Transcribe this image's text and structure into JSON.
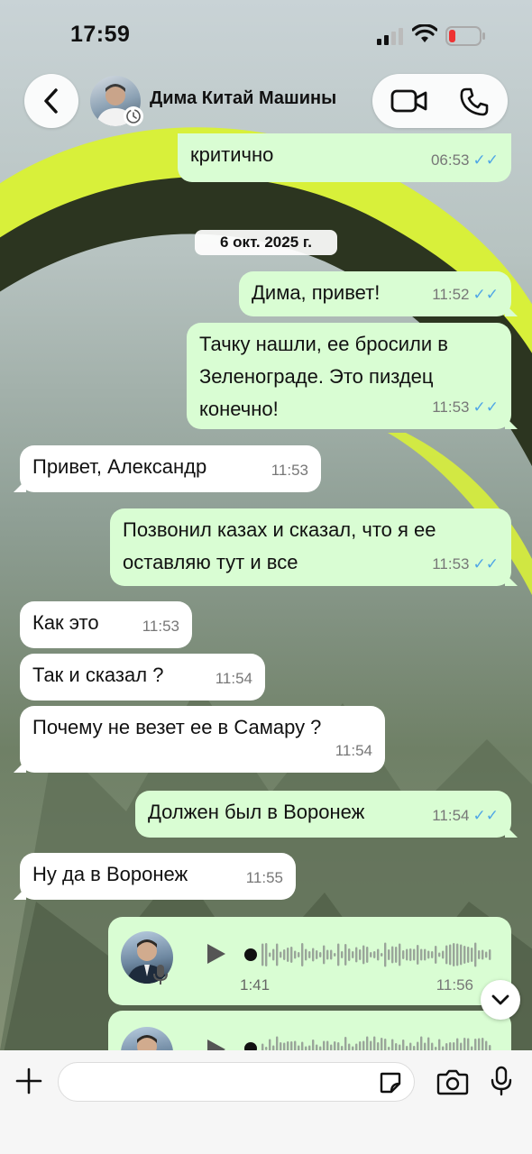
{
  "status_bar": {
    "time": "17:59"
  },
  "header": {
    "contact_name": "Дима Китай Машины"
  },
  "date_separator": "6 окт. 2025 г.",
  "messages": [
    {
      "text": "критично",
      "time": "06:53",
      "dir": "out"
    },
    {
      "text": "Дима, привет!",
      "time": "11:52",
      "dir": "out"
    },
    {
      "text": "Тачку нашли, ее бросили в\nЗеленограде. Это пиздец\nконечно!",
      "time": "11:53",
      "dir": "out"
    },
    {
      "text": "Привет, Александр",
      "time": "11:53",
      "dir": "in"
    },
    {
      "text": "Позвонил казах и сказал, что я ее\nоставляю тут и все",
      "time": "11:53",
      "dir": "out"
    },
    {
      "text": "Как это",
      "time": "11:53",
      "dir": "in"
    },
    {
      "text": "Так и сказал ?",
      "time": "11:54",
      "dir": "in"
    },
    {
      "text": "Почему не везет ее в Самару ?",
      "time": "11:54",
      "dir": "in"
    },
    {
      "text": "Должен был в Воронеж",
      "time": "11:54",
      "dir": "out"
    },
    {
      "text": "Ну да в Воронеж",
      "time": "11:55",
      "dir": "in"
    }
  ],
  "voice_messages": [
    {
      "duration": "1:41",
      "time": "11:56"
    },
    {
      "duration": "",
      "time": ""
    }
  ],
  "colors": {
    "outgoing_bubble": "#d9fdd3",
    "incoming_bubble": "#ffffff",
    "read_tick": "#4fa6e6"
  }
}
